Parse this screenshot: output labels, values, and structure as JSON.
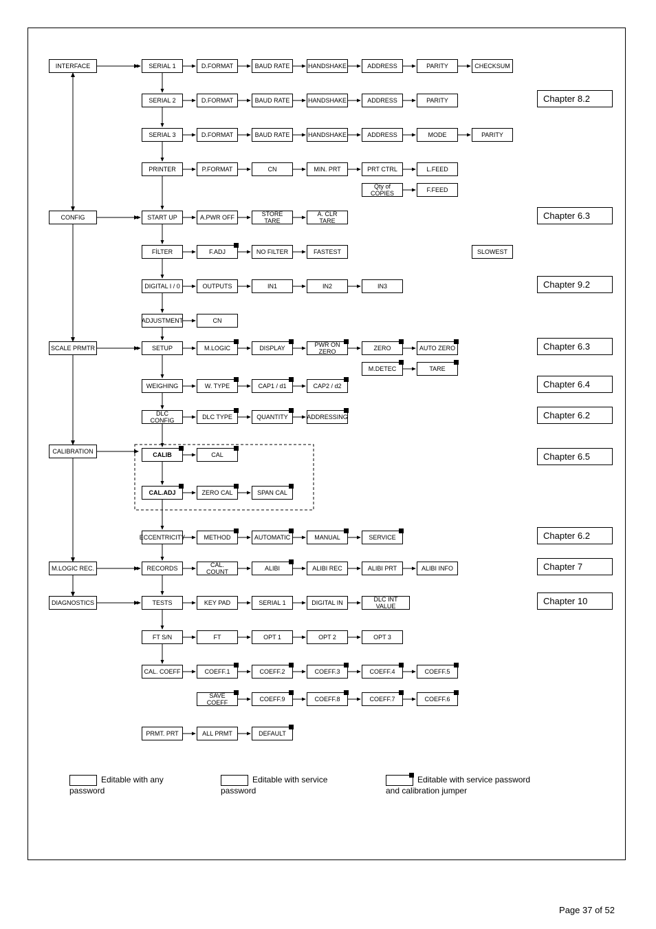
{
  "chart_data": {
    "type": "diagram",
    "description": "Configuration menu hierarchy flowchart",
    "sections": [
      {
        "root": "INTERFACE",
        "chapter": "Chapter 8.2",
        "branches": [
          {
            "name": "SERIAL 1",
            "items": [
              "D.FORMAT",
              "BAUD RATE",
              "HANDSHAKE",
              "ADDRESS",
              "PARITY",
              "CHECKSUM"
            ]
          },
          {
            "name": "SERIAL 2",
            "items": [
              "D.FORMAT",
              "BAUD RATE",
              "HANDSHAKE",
              "ADDRESS",
              "PARITY"
            ]
          },
          {
            "name": "SERIAL 3",
            "items": [
              "D.FORMAT",
              "BAUD RATE",
              "HANDSHAKE",
              "ADDRESS",
              "MODE",
              "PARITY"
            ]
          },
          {
            "name": "PRINTER",
            "items": [
              "P.FORMAT",
              "CN",
              "MIN. PRT",
              "PRT CTRL",
              "L.FEED",
              "Qty of COPIES",
              "F.FEED"
            ]
          }
        ]
      },
      {
        "root": "CONFIG",
        "branches": [
          {
            "name": "START UP",
            "chapter": "Chapter 6.3",
            "items": [
              "A.PWR OFF",
              "STORE TARE",
              "A. CLR TARE"
            ]
          },
          {
            "name": "FİLTER",
            "items": [
              "F.ADJ",
              "NO FILTER",
              "FASTEST",
              "SLOWEST"
            ]
          },
          {
            "name": "DIGITAL I / 0",
            "chapter": "Chapter 9.2",
            "items": [
              "OUTPUTS",
              "IN1",
              "IN2",
              "IN3"
            ]
          },
          {
            "name": "ADJUSTMENT",
            "items": [
              "CN"
            ]
          }
        ]
      },
      {
        "root": "SCALE PRMTR",
        "branches": [
          {
            "name": "SETUP",
            "chapter": "Chapter 6.3",
            "items": [
              "M.LOGIC",
              "DISPLAY",
              "PWR ON ZERO",
              "ZERO",
              "AUTO ZERO",
              "M.DETEC",
              "TARE"
            ]
          },
          {
            "name": "WEIGHING",
            "chapter": "Chapter 6.4",
            "items": [
              "W. TYPE",
              "CAP1 / d1",
              "CAP2 / d2"
            ]
          },
          {
            "name": "DLC CONFIG",
            "chapter": "Chapter 6.2",
            "items": [
              "DLC TYPE",
              "QUANTITY",
              "ADDRESSING"
            ]
          }
        ]
      },
      {
        "root": "CALIBRATION",
        "chapter": "Chapter 6.5",
        "branches": [
          {
            "name": "CALIB",
            "items": [
              "CAL"
            ],
            "marked": true
          },
          {
            "name": "CAL.ADJ",
            "items": [
              "ZERO CAL",
              "SPAN CAL"
            ],
            "marked": true
          },
          {
            "name": "ECCENTRICITY",
            "chapter": "Chapter 6.2",
            "items": [
              "METHOD",
              "AUTOMATIC",
              "MANUAL",
              "SERVICE"
            ]
          }
        ]
      },
      {
        "root": "M.LOGIC REC.",
        "chapter": "Chapter 7",
        "branches": [
          {
            "name": "RECORDS",
            "items": [
              "CAL. COUNT",
              "ALIBI",
              "ALIBI REC",
              "ALIBI PRT",
              "ALIBI INFO"
            ]
          }
        ]
      },
      {
        "root": "DIAGNOSTICS",
        "chapter": "Chapter 10",
        "branches": [
          {
            "name": "TESTS",
            "items": [
              "KEY PAD",
              "SERIAL 1",
              "DIGITAL IN",
              "DLC INT VALUE"
            ]
          },
          {
            "name": "FT S/N",
            "items": [
              "FT",
              "OPT 1",
              "OPT 2",
              "OPT 3"
            ]
          },
          {
            "name": "CAL. COEFF",
            "items": [
              "COEFF.1",
              "COEFF.2",
              "COEFF.3",
              "COEFF.4",
              "COEFF.5",
              "SAVE COEFF",
              "COEFF.9",
              "COEFF.8",
              "COEFF.7",
              "COEFF.6"
            ]
          },
          {
            "name": "PRMT. PRT",
            "items": [
              "ALL PRMT",
              "DEFAULT"
            ]
          }
        ]
      }
    ]
  },
  "n": {
    "interface": "INTERFACE",
    "serial1": "SERIAL 1",
    "serial2": "SERIAL 2",
    "serial3": "SERIAL 3",
    "printer": "PRINTER",
    "dformat": "D.FORMAT",
    "baudrate": "BAUD RATE",
    "handshake": "HANDSHAKE",
    "address": "ADDRESS",
    "parity": "PARITY",
    "checksum": "CHECKSUM",
    "mode": "MODE",
    "pformat": "P.FORMAT",
    "cn": "CN",
    "minprt": "MIN. PRT",
    "prtctrl": "PRT CTRL",
    "lfeed": "L.FEED",
    "qtycopies": "Qty of COPIES",
    "ffeed": "F.FEED",
    "config": "CONFIG",
    "startup": "START UP",
    "apwroff": "A.PWR OFF",
    "storetare": "STORE TARE",
    "aclrtare": "A. CLR TARE",
    "filter": "FİLTER",
    "fadj": "F.ADJ",
    "nofilter": "NO FILTER",
    "fastest": "FASTEST",
    "slowest": "SLOWEST",
    "digitalio": "DIGITAL I / 0",
    "outputs": "OUTPUTS",
    "in1": "IN1",
    "in2": "IN2",
    "in3": "IN3",
    "adjustment": "ADJUSTMENT",
    "scaleprmtr": "SCALE PRMTR",
    "setup": "SETUP",
    "mlogic": "M.LOGIC",
    "display": "DISPLAY",
    "pwronzero": "PWR ON ZERO",
    "zero": "ZERO",
    "autozero": "AUTO ZERO",
    "mdetec": "M.DETEC",
    "tare": "TARE",
    "weighing": "WEIGHING",
    "wtype": "W. TYPE",
    "cap1": "CAP1 / d1",
    "cap2": "CAP2 / d2",
    "dlcconfig": "DLC CONFIG",
    "dlctype": "DLC TYPE",
    "quantity": "QUANTITY",
    "addressing": "ADDRESSING",
    "calibration": "CALIBRATION",
    "calib": "CALIB",
    "cal": "CAL",
    "caladj": "CAL.ADJ",
    "zerocal": "ZERO CAL",
    "spancal": "SPAN CAL",
    "eccentricity": "ECCENTRICITY",
    "method": "METHOD",
    "automatic": "AUTOMATIC",
    "manual": "MANUAL",
    "service": "SERVICE",
    "mlogicrec": "M.LOGIC REC.",
    "records": "RECORDS",
    "calcount": "CAL. COUNT",
    "alibi": "ALIBI",
    "alibirec": "ALIBI REC",
    "alibiprt": "ALIBI PRT",
    "alibiinfo": "ALIBI INFO",
    "diagnostics": "DIAGNOSTICS",
    "tests": "TESTS",
    "keypad": "KEY PAD",
    "digitalin": "DIGITAL IN",
    "dlcintvalue": "DLC INT VALUE",
    "ftsn": "FT S/N",
    "ft": "FT",
    "opt1": "OPT 1",
    "opt2": "OPT 2",
    "opt3": "OPT 3",
    "calcoeff": "CAL. COEFF",
    "coeff1": "COEFF.1",
    "coeff2": "COEFF.2",
    "coeff3": "COEFF.3",
    "coeff4": "COEFF.4",
    "coeff5": "COEFF.5",
    "coeff6": "COEFF.6",
    "coeff7": "COEFF.7",
    "coeff8": "COEFF.8",
    "coeff9": "COEFF.9",
    "savecoeff": "SAVE COEFF",
    "prmtprt": "PRMT. PRT",
    "allprmt": "ALL PRMT",
    "default": "DEFAULT"
  },
  "ch": {
    "c82": "Chapter 8.2",
    "c63": "Chapter 6.3",
    "c92": "Chapter 9.2",
    "c64": "Chapter 6.4",
    "c62": "Chapter 6.2",
    "c65": "Chapter 6.5",
    "c7": "Chapter 7",
    "c10": "Chapter 10"
  },
  "legend": {
    "l1": "Editable with any password",
    "l2": "Editable with service password",
    "l3": "Editable with service password and calibration jumper"
  },
  "footer": "Page 37 of 52"
}
